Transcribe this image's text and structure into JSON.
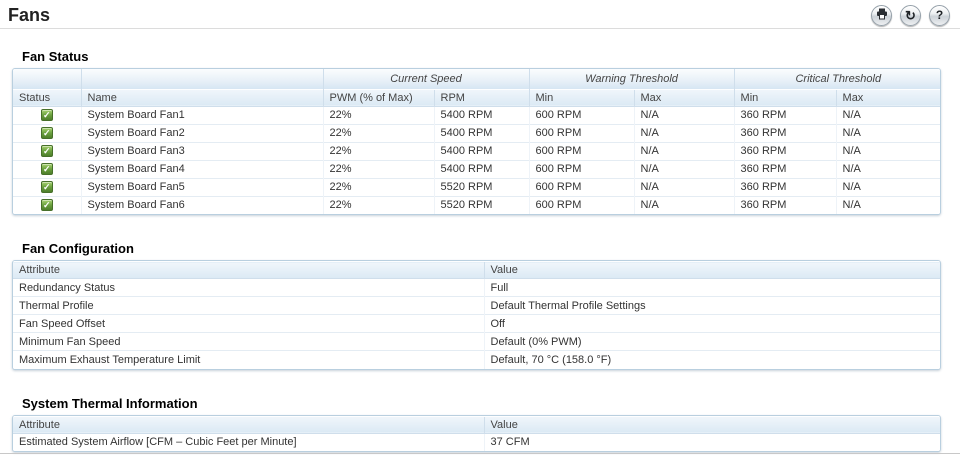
{
  "page": {
    "title": "Fans"
  },
  "icons": {
    "status_ok": "✓",
    "refresh": "↻",
    "help": "?"
  },
  "colors": {
    "header_blue_top": "#f0f6fb",
    "header_blue_bottom": "#d6e6f3",
    "table_border": "#b9cfdf",
    "status_green": "#5d9732"
  },
  "fan_status": {
    "section_title": "Fan Status",
    "group_headers": [
      "Current Speed",
      "Warning Threshold",
      "Critical Threshold"
    ],
    "columns": [
      "Status",
      "Name",
      "PWM (% of Max)",
      "RPM",
      "Min",
      "Max",
      "Min",
      "Max"
    ],
    "rows": [
      {
        "status": "ok",
        "name": "System Board Fan1",
        "pwm": "22%",
        "rpm": "5400 RPM",
        "warn_min": "600 RPM",
        "warn_max": "N/A",
        "crit_min": "360 RPM",
        "crit_max": "N/A"
      },
      {
        "status": "ok",
        "name": "System Board Fan2",
        "pwm": "22%",
        "rpm": "5400 RPM",
        "warn_min": "600 RPM",
        "warn_max": "N/A",
        "crit_min": "360 RPM",
        "crit_max": "N/A"
      },
      {
        "status": "ok",
        "name": "System Board Fan3",
        "pwm": "22%",
        "rpm": "5400 RPM",
        "warn_min": "600 RPM",
        "warn_max": "N/A",
        "crit_min": "360 RPM",
        "crit_max": "N/A"
      },
      {
        "status": "ok",
        "name": "System Board Fan4",
        "pwm": "22%",
        "rpm": "5400 RPM",
        "warn_min": "600 RPM",
        "warn_max": "N/A",
        "crit_min": "360 RPM",
        "crit_max": "N/A"
      },
      {
        "status": "ok",
        "name": "System Board Fan5",
        "pwm": "22%",
        "rpm": "5520 RPM",
        "warn_min": "600 RPM",
        "warn_max": "N/A",
        "crit_min": "360 RPM",
        "crit_max": "N/A"
      },
      {
        "status": "ok",
        "name": "System Board Fan6",
        "pwm": "22%",
        "rpm": "5520 RPM",
        "warn_min": "600 RPM",
        "warn_max": "N/A",
        "crit_min": "360 RPM",
        "crit_max": "N/A"
      }
    ]
  },
  "fan_configuration": {
    "section_title": "Fan Configuration",
    "columns": [
      "Attribute",
      "Value"
    ],
    "rows": [
      {
        "attribute": "Redundancy Status",
        "value": "Full"
      },
      {
        "attribute": "Thermal Profile",
        "value": "Default Thermal Profile Settings"
      },
      {
        "attribute": "Fan Speed Offset",
        "value": "Off"
      },
      {
        "attribute": "Minimum Fan Speed",
        "value": "Default (0% PWM)"
      },
      {
        "attribute": "Maximum Exhaust Temperature Limit",
        "value": "Default, 70 °C (158.0 °F)"
      }
    ]
  },
  "system_thermal_information": {
    "section_title": "System Thermal Information",
    "columns": [
      "Attribute",
      "Value"
    ],
    "rows": [
      {
        "attribute": "Estimated System Airflow [CFM – Cubic Feet per Minute]",
        "value": "37 CFM"
      }
    ]
  }
}
